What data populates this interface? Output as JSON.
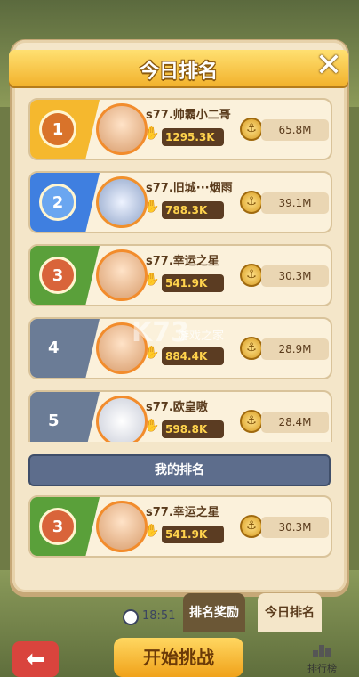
{
  "dialog": {
    "title": "今日排名",
    "close_symbol": "✕"
  },
  "rows": [
    {
      "rank": "1",
      "name": "s77.帅霸小二哥",
      "power": "1295.3K",
      "score": "65.8M",
      "medal_color": "#f2b32e"
    },
    {
      "rank": "2",
      "name": "s77.旧城···烟雨",
      "power": "788.3K",
      "score": "39.1M",
      "medal_color": "#3f7fe0"
    },
    {
      "rank": "3",
      "name": "s77.幸运之星",
      "power": "541.9K",
      "score": "30.3M",
      "medal_color": "#5aa03a"
    },
    {
      "rank": "4",
      "name": "",
      "power": "884.4K",
      "score": "28.9M",
      "medal_color": "#6b7c96"
    },
    {
      "rank": "5",
      "name": "s77.欧皇嗷",
      "power": "598.8K",
      "score": "28.4M",
      "medal_color": "#6b7c96"
    }
  ],
  "my_rank": {
    "label": "我的排名",
    "row": {
      "rank": "3",
      "name": "s77.幸运之星",
      "power": "541.9K",
      "score": "30.3M",
      "medal_color": "#5aa03a"
    }
  },
  "tabs": {
    "reward": "排名奖励",
    "today": "今日排名"
  },
  "timer": "18:51",
  "bottom": {
    "back_symbol": "⬅",
    "start_label": "开始挑战",
    "leaderboard_label": "排行榜"
  },
  "watermark": {
    "main": "K73",
    "sub": "游戏之家"
  }
}
